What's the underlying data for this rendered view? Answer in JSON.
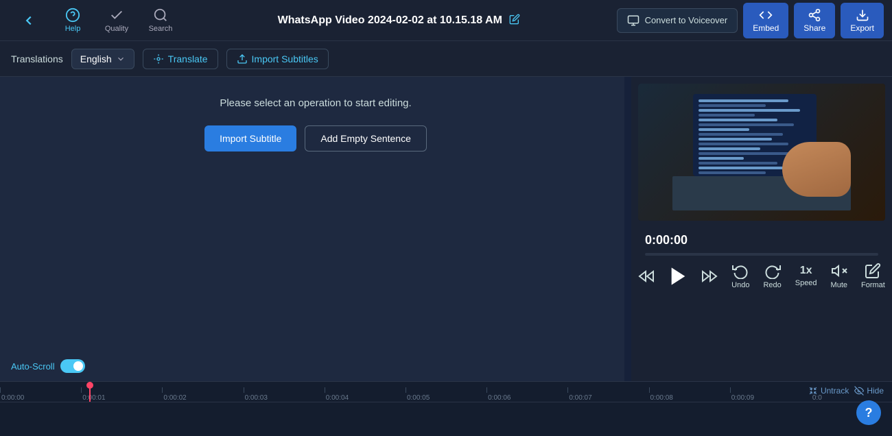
{
  "navbar": {
    "back_label": "",
    "help_label": "Help",
    "quality_label": "Quality",
    "search_label": "Search",
    "title": "WhatsApp Video 2024-02-02 at 10.15.18 AM",
    "convert_label": "Convert to Voiceover",
    "embed_label": "Embed",
    "share_label": "Share",
    "export_label": "Export"
  },
  "subtitle_toolbar": {
    "translations_label": "Translations",
    "language": "English",
    "translate_label": "Translate",
    "import_subtitles_label": "Import Subtitles"
  },
  "editor": {
    "prompt": "Please select an operation to start editing.",
    "import_subtitle_btn": "Import Subtitle",
    "add_empty_btn": "Add Empty Sentence",
    "auto_scroll_label": "Auto-Scroll"
  },
  "video_player": {
    "time": "0:00:00",
    "progress": 0
  },
  "controls": {
    "undo_label": "Undo",
    "redo_label": "Redo",
    "speed_label": "Speed",
    "speed_value": "1x",
    "mute_label": "Mute",
    "format_label": "Format"
  },
  "timeline": {
    "untrack_label": "Untrack",
    "hide_label": "Hide",
    "ticks": [
      "0:00:00",
      "0:00:01",
      "0:00:02",
      "0:00:03",
      "0:00:04",
      "0:00:05",
      "0:00:06",
      "0:00:07",
      "0:00:08",
      "0:00:09",
      "0:0"
    ]
  }
}
